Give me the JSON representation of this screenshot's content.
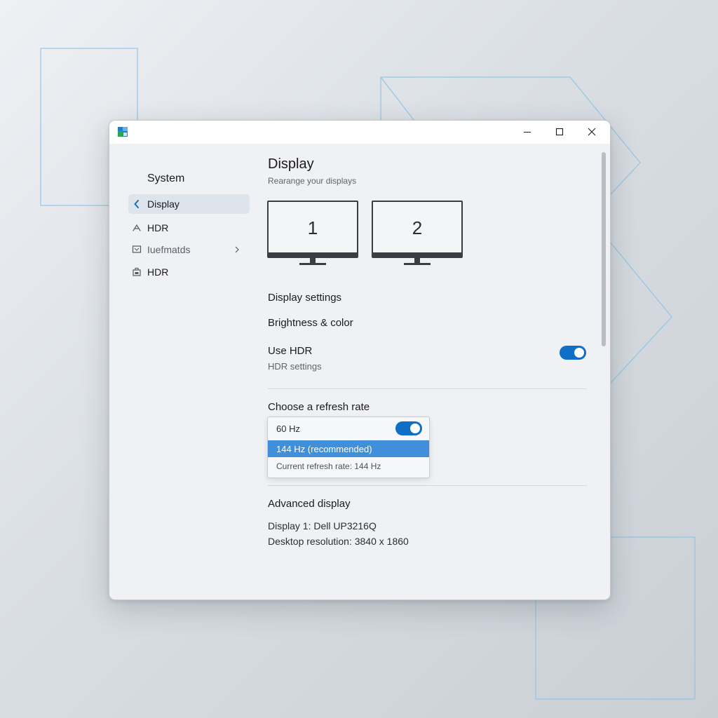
{
  "window": {
    "controls": {
      "minimize": "minimize-icon",
      "maximize": "maximize-icon",
      "close": "close-icon"
    }
  },
  "sidebar": {
    "heading": "System",
    "items": [
      {
        "label": "Display",
        "icon": "chevron-left-icon",
        "active": true
      },
      {
        "label": "HDR",
        "icon": "hdr-icon"
      },
      {
        "label": "Iuefmatds",
        "icon": "monitor-small-icon",
        "has_submenu": true
      },
      {
        "label": "HDR",
        "icon": "battery-icon"
      }
    ]
  },
  "content": {
    "title": "Display",
    "subtitle": "Rearange your displays",
    "monitors": [
      "1",
      "2"
    ],
    "display_settings": "Display settings",
    "brightness_color": "Brightness & color",
    "hdr": {
      "label": "Use HDR",
      "sub": "HDR settings",
      "enabled": true
    },
    "refresh": {
      "label": "Choose a refresh rate",
      "options": [
        "60 Hz",
        "144 Hz (recommended)"
      ],
      "selected": "144 Hz (recommended)",
      "toggle_on": true,
      "current": "Current refresh rate: 144 Hz"
    },
    "advanced": {
      "label": "Advanced display",
      "lines": [
        "Display 1: Dell UP3216Q",
        "Desktop resolution: 3840 x 1860"
      ]
    }
  },
  "colors": {
    "accent": "#0f6fc6",
    "selection": "#3f8fdb",
    "active_nav": "#dde4ec"
  }
}
